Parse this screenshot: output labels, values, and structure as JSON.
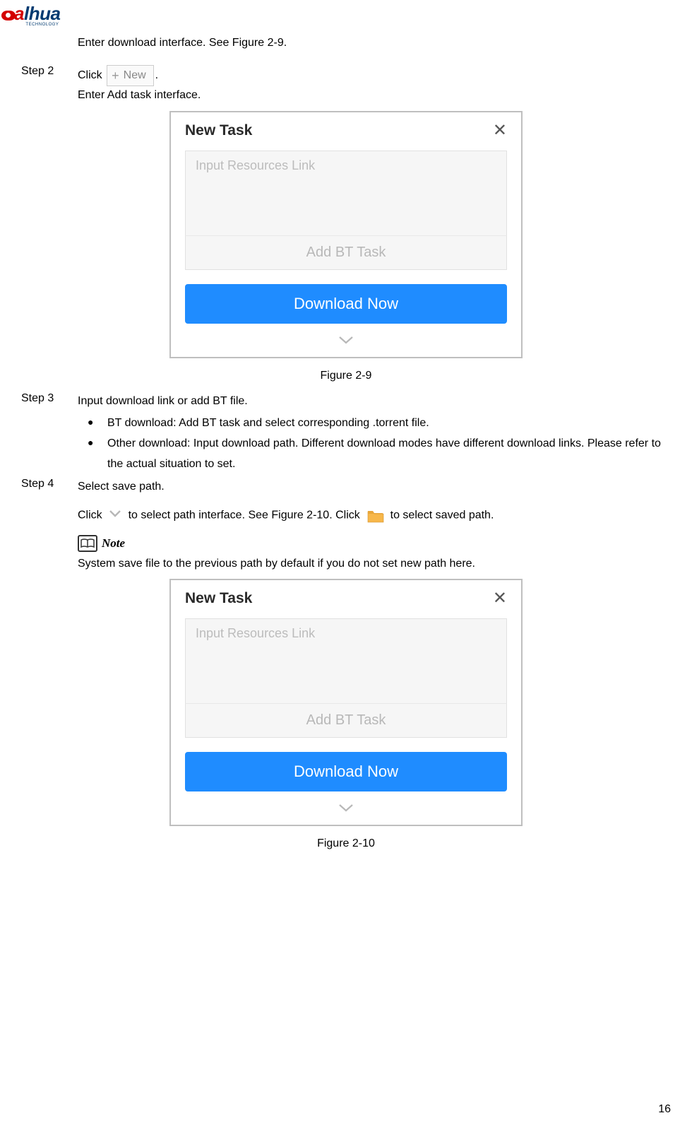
{
  "logo": {
    "brand_a": "a",
    "brand_rest": "lhua",
    "sub": "TECHNOLOGY"
  },
  "intro": "Enter download interface. See Figure 2-9.",
  "step2": {
    "label": "Step 2",
    "click_pre": "Click",
    "new_btn": "New",
    "click_post": ".",
    "line2": "Enter Add task interface."
  },
  "dialog": {
    "title": "New Task",
    "placeholder": "Input Resources Link",
    "bt": "Add BT Task",
    "download": "Download Now"
  },
  "fig29": "Figure 2-9",
  "step3": {
    "label": "Step 3",
    "line": "Input download link or add BT file.",
    "b1": "BT download: Add BT task and select corresponding .torrent file.",
    "b2": "Other download: Input download path. Different download modes have different download links. Please refer to the actual situation to set."
  },
  "step4": {
    "label": "Step 4",
    "line": "Select save path.",
    "click1_pre": "Click",
    "click1_mid": " to select path interface. See Figure 2-10. Click ",
    "click1_post": " to select saved path."
  },
  "note": {
    "label": "Note",
    "text": "System save file to the previous path by default if you do not set new path here."
  },
  "fig210": "Figure 2-10",
  "page_number": "16"
}
